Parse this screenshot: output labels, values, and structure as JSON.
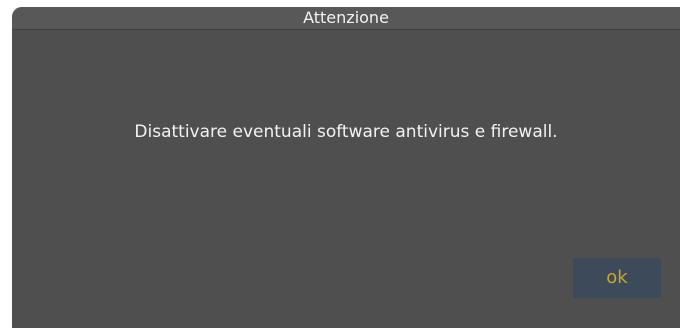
{
  "dialog": {
    "title": "Attenzione",
    "message": "Disattivare eventuali software antivirus e firewall.",
    "ok_label": "ok"
  },
  "colors": {
    "dialog_background": "#4f4f4f",
    "title_text": "#f2f2f2",
    "button_background": "#3d4a59",
    "button_text": "#c8a82a"
  }
}
